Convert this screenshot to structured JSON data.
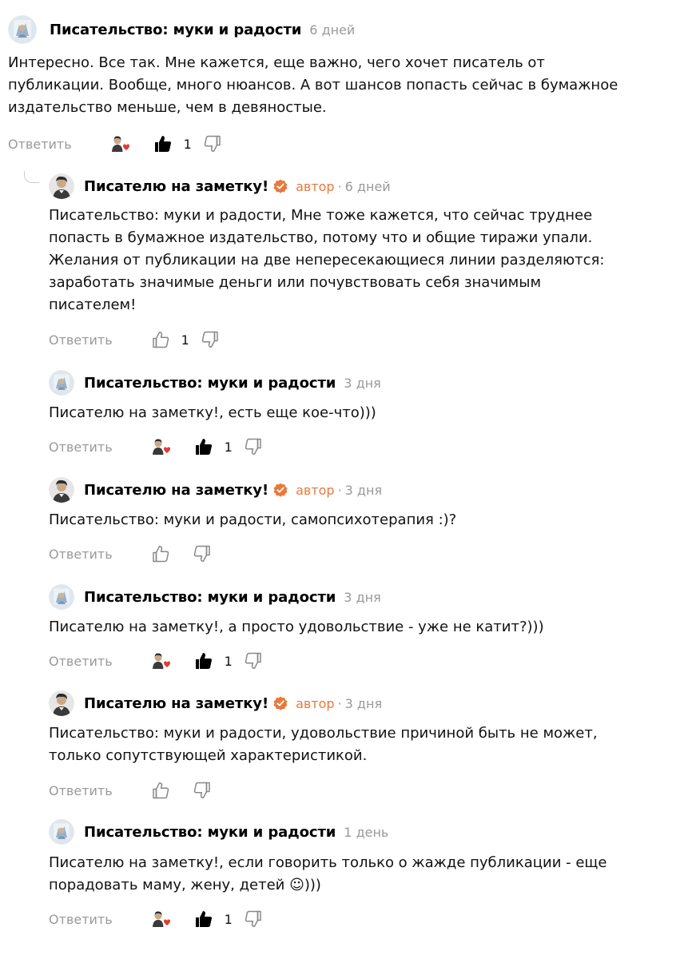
{
  "colors": {
    "author_badge": "#e8783c",
    "muted": "#999999",
    "text": "#111111"
  },
  "icons": {
    "like": "thumbs-up-icon",
    "dislike": "thumbs-down-icon",
    "verified": "verified-check-icon",
    "liker_avatar": "liker-avatar-heart-icon"
  },
  "common": {
    "reply_label": "Ответить",
    "author_label": "автор",
    "separator": "·"
  },
  "comments": [
    {
      "author": "Писательство: муки и радости",
      "time": "6 дней",
      "text": "Интересно. Все так. Мне кажется, еще важно, чего хочет писатель от\nпубликации. Вообще, много нюансов. А вот шансов попасть сейчас в бумажное\nиздательство меньше, чем в девяностые.",
      "likes": "1",
      "liked_by_author": true
    },
    {
      "author": "Писателю на заметку!",
      "time": "6 дней",
      "text": "Писательство: муки и радости, Мне тоже кажется, что сейчас труднее\nпопасть в бумажное издательство, потому что и общие тиражи упали.\nЖелания от публикации на две непересекающиеся линии разделяются:\nзаработать значимые деньги или почувствовать себя значимым\nписателем!",
      "likes": "1"
    },
    {
      "author": "Писательство: муки и радости",
      "time": "3 дня",
      "text": "Писателю на заметку!, есть еще кое-что)))",
      "likes": "1",
      "liked_by_author": true
    },
    {
      "author": "Писателю на заметку!",
      "time": "3 дня",
      "text": "Писательство: муки и радости, самопсихотерапия :)?",
      "likes": ""
    },
    {
      "author": "Писательство: муки и радости",
      "time": "3 дня",
      "text": "Писателю на заметку!, а просто удовольствие - уже не катит?)))",
      "likes": "1",
      "liked_by_author": true
    },
    {
      "author": "Писателю на заметку!",
      "time": "3 дня",
      "text": "Писательство: муки и радости, удовольствие причиной быть не может,\nтолько сопутствующей характеристикой.",
      "likes": ""
    },
    {
      "author": "Писательство: муки и радости",
      "time": "1 день",
      "text": "Писателю на заметку!, если говорить только о жажде публикации - еще\nпорадовать маму, жену, детей ☺)))",
      "likes": "1",
      "liked_by_author": true
    }
  ]
}
